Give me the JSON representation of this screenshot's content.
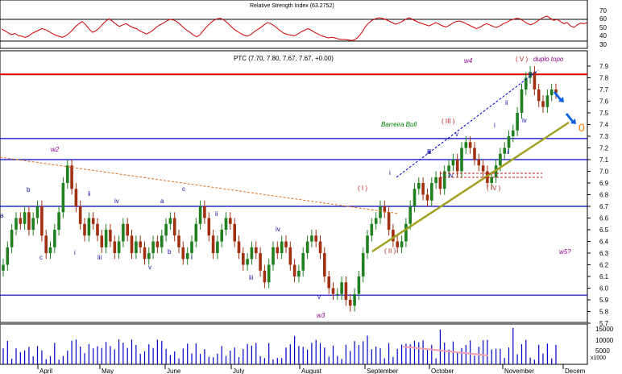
{
  "rsi": {
    "title": "Relative Strength Index (63.2752)",
    "ticks": [
      "70",
      "60",
      "50",
      "40",
      "30"
    ],
    "upper_level": 70,
    "lower_level": 30,
    "values": [
      52,
      49,
      45,
      42,
      44,
      40,
      39,
      37,
      39,
      44,
      47,
      50,
      53,
      51,
      48,
      44,
      41,
      39,
      37,
      40,
      44,
      50,
      57,
      62,
      66,
      60,
      52,
      46,
      49,
      54,
      61,
      67,
      71,
      66,
      61,
      57,
      60,
      62,
      58,
      55,
      53,
      49,
      46,
      43,
      46,
      50,
      56,
      60,
      63,
      67,
      70,
      69,
      66,
      61,
      55,
      50,
      46,
      41,
      38,
      42,
      50,
      57,
      63,
      68,
      71,
      72,
      69,
      64,
      58,
      52,
      48,
      44,
      41,
      39,
      42,
      47,
      51,
      55,
      60,
      64,
      62,
      58,
      53,
      48,
      44,
      42,
      41,
      40,
      43,
      47,
      50,
      53,
      50,
      46,
      43,
      40,
      38,
      36,
      37,
      36,
      34,
      33,
      33,
      32,
      31,
      33,
      38,
      46,
      56,
      63,
      68,
      71,
      73,
      72,
      70,
      67,
      64,
      61,
      63,
      66,
      70,
      73,
      70,
      67,
      64,
      62,
      60,
      58,
      61,
      64,
      61,
      58,
      56,
      59,
      63,
      66,
      67,
      65,
      62,
      59,
      56,
      53,
      55,
      59,
      62,
      60,
      57,
      55,
      58,
      62,
      64,
      68,
      70,
      72,
      71,
      67,
      63,
      60,
      62,
      66,
      70,
      74,
      76,
      72,
      68,
      70,
      66,
      62,
      64,
      58,
      55,
      60,
      63,
      62,
      64
    ]
  },
  "price_panel": {
    "title": "PTC (7.70, 7.80, 7.67, 7.67, +0.00)",
    "y_ticks": [
      "7.9",
      "7.8",
      "7.7",
      "7.6",
      "7.5",
      "7.4",
      "7.3",
      "7.2",
      "7.1",
      "7.0",
      "6.9",
      "6.8",
      "6.7",
      "6.6",
      "6.5",
      "6.4",
      "6.3",
      "6.2",
      "6.1",
      "6.0",
      "5.9",
      "5.8",
      "5.7"
    ],
    "horizontal_levels": [
      {
        "value": 7.83,
        "color": "#e00000"
      },
      {
        "value": 7.28,
        "color": "#0000cc"
      },
      {
        "value": 7.1,
        "color": "#0000cc"
      },
      {
        "value": 6.7,
        "color": "#0000cc"
      },
      {
        "value": 5.94,
        "color": "#0000cc"
      }
    ],
    "annotations": {
      "barreira": "Barreira Bull",
      "duplo_topo": "duplo topo",
      "circle_zero": "0"
    },
    "wave_labels": {
      "w2": "w2",
      "w3": "w3",
      "w4": "w4",
      "w5": "w5?",
      "I": "( I )",
      "II": "( II )",
      "III": "( III )",
      "IV": "( IV )",
      "V": "( V )",
      "a": "a",
      "b": "b",
      "c": "c",
      "i": "i",
      "ii": "ii",
      "iii": "iii",
      "iv": "iv",
      "v": "v"
    }
  },
  "volume": {
    "y_ticks": [
      "15000",
      "10000",
      "5000"
    ],
    "unit_label": "x1000"
  },
  "x_axis": {
    "months": [
      "April",
      "May",
      "June",
      "July",
      "August",
      "September",
      "October",
      "November",
      "Decem"
    ]
  },
  "chart_data": {
    "type": "candlestick",
    "title": "PTC (7.70, 7.80, 7.67, 7.67, +0.00)",
    "x_categories": [
      "April",
      "May",
      "June",
      "July",
      "August",
      "September",
      "October",
      "November",
      "December"
    ],
    "ylim": [
      5.7,
      8.0
    ],
    "close_series": [
      6.2,
      6.35,
      6.5,
      6.6,
      6.55,
      6.65,
      6.5,
      6.6,
      6.7,
      6.45,
      6.3,
      6.35,
      6.5,
      6.65,
      6.9,
      7.05,
      6.85,
      6.7,
      6.55,
      6.45,
      6.6,
      6.55,
      6.45,
      6.35,
      6.5,
      6.4,
      6.3,
      6.4,
      6.55,
      6.45,
      6.3,
      6.4,
      6.35,
      6.25,
      6.3,
      6.4,
      6.35,
      6.45,
      6.55,
      6.6,
      6.45,
      6.35,
      6.25,
      6.3,
      6.4,
      6.55,
      6.7,
      6.6,
      6.45,
      6.3,
      6.4,
      6.5,
      6.6,
      6.55,
      6.4,
      6.3,
      6.2,
      6.25,
      6.35,
      6.3,
      6.15,
      6.05,
      6.2,
      6.35,
      6.3,
      6.4,
      6.35,
      6.2,
      6.1,
      6.15,
      6.3,
      6.4,
      6.45,
      6.4,
      6.3,
      6.1,
      6.0,
      5.95,
      5.95,
      6.05,
      5.9,
      5.85,
      5.95,
      6.1,
      6.3,
      6.45,
      6.55,
      6.6,
      6.7,
      6.65,
      6.5,
      6.4,
      6.35,
      6.4,
      6.55,
      6.7,
      6.85,
      6.9,
      6.8,
      6.75,
      6.9,
      6.95,
      6.85,
      7.0,
      7.05,
      7.1,
      7.0,
      7.2,
      7.25,
      7.2,
      7.1,
      7.05,
      7.0,
      6.9,
      6.95,
      7.05,
      7.15,
      7.2,
      7.3,
      7.35,
      7.5,
      7.7,
      7.8,
      7.85,
      7.7,
      7.6,
      7.55,
      7.65,
      7.7,
      7.67
    ]
  }
}
